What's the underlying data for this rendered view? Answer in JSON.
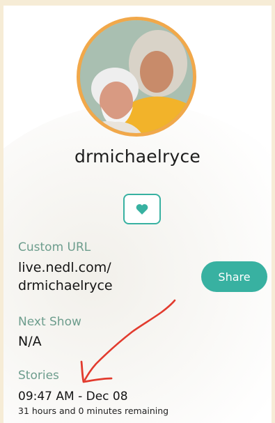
{
  "profile": {
    "username": "drmichaelryce"
  },
  "custom_url": {
    "label": "Custom URL",
    "line1": "live.nedl.com/",
    "line2": "drmichaelryce",
    "share_label": "Share"
  },
  "next_show": {
    "label": "Next Show",
    "value": "N/A"
  },
  "stories": {
    "label": "Stories",
    "time": "09:47 AM - Dec 08",
    "remaining": "31 hours and 0 minutes remaining"
  },
  "colors": {
    "accent": "#38b1a1",
    "avatar_ring": "#f1a84a",
    "label_text": "#6d9d8d",
    "annotation": "#e23b2e"
  },
  "icons": {
    "heart": "heart-icon"
  }
}
